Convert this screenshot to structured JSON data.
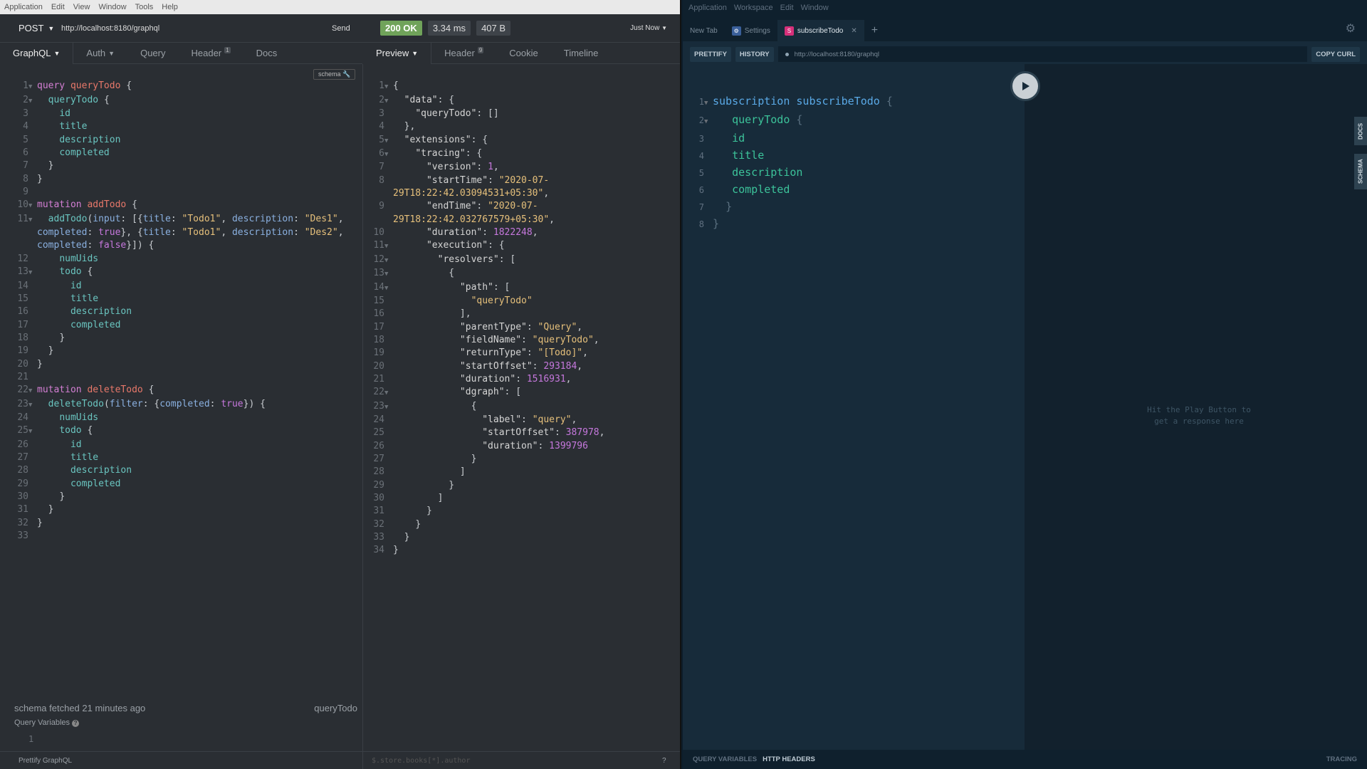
{
  "insomnia": {
    "menu": [
      "Application",
      "Edit",
      "View",
      "Window",
      "Tools",
      "Help"
    ],
    "method": "POST",
    "url": "http://localhost:8180/graphql",
    "send": "Send",
    "status": "200 OK",
    "time": "3.34 ms",
    "size": "407 B",
    "when": "Just Now",
    "req_tabs": {
      "graphql": "GraphQL",
      "auth": "Auth",
      "query": "Query",
      "header": "Header",
      "header_count": "1",
      "docs": "Docs"
    },
    "res_tabs": {
      "preview": "Preview",
      "header": "Header",
      "header_count": "9",
      "cookie": "Cookie",
      "timeline": "Timeline"
    },
    "schema_badge": "schema",
    "schema_fetched": "schema fetched 21 minutes ago",
    "operation": "queryTodo",
    "query_variables": "Query Variables",
    "var_line": "1",
    "prettify": "Prettify GraphQL",
    "filter_placeholder": "$.store.books[*].author"
  },
  "playground": {
    "menu": [
      "Application",
      "Workspace",
      "Edit",
      "Window"
    ],
    "tabs": {
      "new": "New Tab",
      "settings": "Settings",
      "sub": "subscribeTodo"
    },
    "prettify": "PRETTIFY",
    "history": "HISTORY",
    "url": "http://localhost:8180/graphql",
    "copy_curl": "COPY CURL",
    "hint": "Hit the Play Button to get a response here",
    "docs": "DOCS",
    "schema": "SCHEMA",
    "query_vars": "QUERY VARIABLES",
    "http_headers": "HTTP HEADERS",
    "tracing": "TRACING"
  },
  "colors": {
    "ok": "#70a35a",
    "playground_bg": "#172b3a",
    "insomnia_bg": "#2a2e33"
  }
}
